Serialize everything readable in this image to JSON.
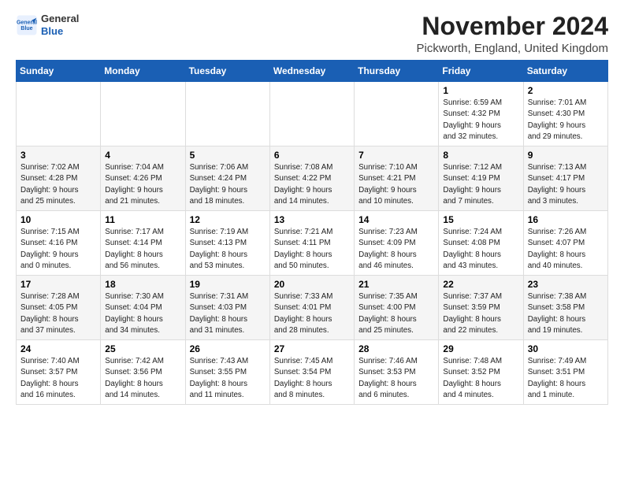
{
  "header": {
    "logo_line1": "General",
    "logo_line2": "Blue",
    "month": "November 2024",
    "location": "Pickworth, England, United Kingdom"
  },
  "weekdays": [
    "Sunday",
    "Monday",
    "Tuesday",
    "Wednesday",
    "Thursday",
    "Friday",
    "Saturday"
  ],
  "weeks": [
    [
      {
        "day": "",
        "info": ""
      },
      {
        "day": "",
        "info": ""
      },
      {
        "day": "",
        "info": ""
      },
      {
        "day": "",
        "info": ""
      },
      {
        "day": "",
        "info": ""
      },
      {
        "day": "1",
        "info": "Sunrise: 6:59 AM\nSunset: 4:32 PM\nDaylight: 9 hours\nand 32 minutes."
      },
      {
        "day": "2",
        "info": "Sunrise: 7:01 AM\nSunset: 4:30 PM\nDaylight: 9 hours\nand 29 minutes."
      }
    ],
    [
      {
        "day": "3",
        "info": "Sunrise: 7:02 AM\nSunset: 4:28 PM\nDaylight: 9 hours\nand 25 minutes."
      },
      {
        "day": "4",
        "info": "Sunrise: 7:04 AM\nSunset: 4:26 PM\nDaylight: 9 hours\nand 21 minutes."
      },
      {
        "day": "5",
        "info": "Sunrise: 7:06 AM\nSunset: 4:24 PM\nDaylight: 9 hours\nand 18 minutes."
      },
      {
        "day": "6",
        "info": "Sunrise: 7:08 AM\nSunset: 4:22 PM\nDaylight: 9 hours\nand 14 minutes."
      },
      {
        "day": "7",
        "info": "Sunrise: 7:10 AM\nSunset: 4:21 PM\nDaylight: 9 hours\nand 10 minutes."
      },
      {
        "day": "8",
        "info": "Sunrise: 7:12 AM\nSunset: 4:19 PM\nDaylight: 9 hours\nand 7 minutes."
      },
      {
        "day": "9",
        "info": "Sunrise: 7:13 AM\nSunset: 4:17 PM\nDaylight: 9 hours\nand 3 minutes."
      }
    ],
    [
      {
        "day": "10",
        "info": "Sunrise: 7:15 AM\nSunset: 4:16 PM\nDaylight: 9 hours\nand 0 minutes."
      },
      {
        "day": "11",
        "info": "Sunrise: 7:17 AM\nSunset: 4:14 PM\nDaylight: 8 hours\nand 56 minutes."
      },
      {
        "day": "12",
        "info": "Sunrise: 7:19 AM\nSunset: 4:13 PM\nDaylight: 8 hours\nand 53 minutes."
      },
      {
        "day": "13",
        "info": "Sunrise: 7:21 AM\nSunset: 4:11 PM\nDaylight: 8 hours\nand 50 minutes."
      },
      {
        "day": "14",
        "info": "Sunrise: 7:23 AM\nSunset: 4:09 PM\nDaylight: 8 hours\nand 46 minutes."
      },
      {
        "day": "15",
        "info": "Sunrise: 7:24 AM\nSunset: 4:08 PM\nDaylight: 8 hours\nand 43 minutes."
      },
      {
        "day": "16",
        "info": "Sunrise: 7:26 AM\nSunset: 4:07 PM\nDaylight: 8 hours\nand 40 minutes."
      }
    ],
    [
      {
        "day": "17",
        "info": "Sunrise: 7:28 AM\nSunset: 4:05 PM\nDaylight: 8 hours\nand 37 minutes."
      },
      {
        "day": "18",
        "info": "Sunrise: 7:30 AM\nSunset: 4:04 PM\nDaylight: 8 hours\nand 34 minutes."
      },
      {
        "day": "19",
        "info": "Sunrise: 7:31 AM\nSunset: 4:03 PM\nDaylight: 8 hours\nand 31 minutes."
      },
      {
        "day": "20",
        "info": "Sunrise: 7:33 AM\nSunset: 4:01 PM\nDaylight: 8 hours\nand 28 minutes."
      },
      {
        "day": "21",
        "info": "Sunrise: 7:35 AM\nSunset: 4:00 PM\nDaylight: 8 hours\nand 25 minutes."
      },
      {
        "day": "22",
        "info": "Sunrise: 7:37 AM\nSunset: 3:59 PM\nDaylight: 8 hours\nand 22 minutes."
      },
      {
        "day": "23",
        "info": "Sunrise: 7:38 AM\nSunset: 3:58 PM\nDaylight: 8 hours\nand 19 minutes."
      }
    ],
    [
      {
        "day": "24",
        "info": "Sunrise: 7:40 AM\nSunset: 3:57 PM\nDaylight: 8 hours\nand 16 minutes."
      },
      {
        "day": "25",
        "info": "Sunrise: 7:42 AM\nSunset: 3:56 PM\nDaylight: 8 hours\nand 14 minutes."
      },
      {
        "day": "26",
        "info": "Sunrise: 7:43 AM\nSunset: 3:55 PM\nDaylight: 8 hours\nand 11 minutes."
      },
      {
        "day": "27",
        "info": "Sunrise: 7:45 AM\nSunset: 3:54 PM\nDaylight: 8 hours\nand 8 minutes."
      },
      {
        "day": "28",
        "info": "Sunrise: 7:46 AM\nSunset: 3:53 PM\nDaylight: 8 hours\nand 6 minutes."
      },
      {
        "day": "29",
        "info": "Sunrise: 7:48 AM\nSunset: 3:52 PM\nDaylight: 8 hours\nand 4 minutes."
      },
      {
        "day": "30",
        "info": "Sunrise: 7:49 AM\nSunset: 3:51 PM\nDaylight: 8 hours\nand 1 minute."
      }
    ]
  ]
}
